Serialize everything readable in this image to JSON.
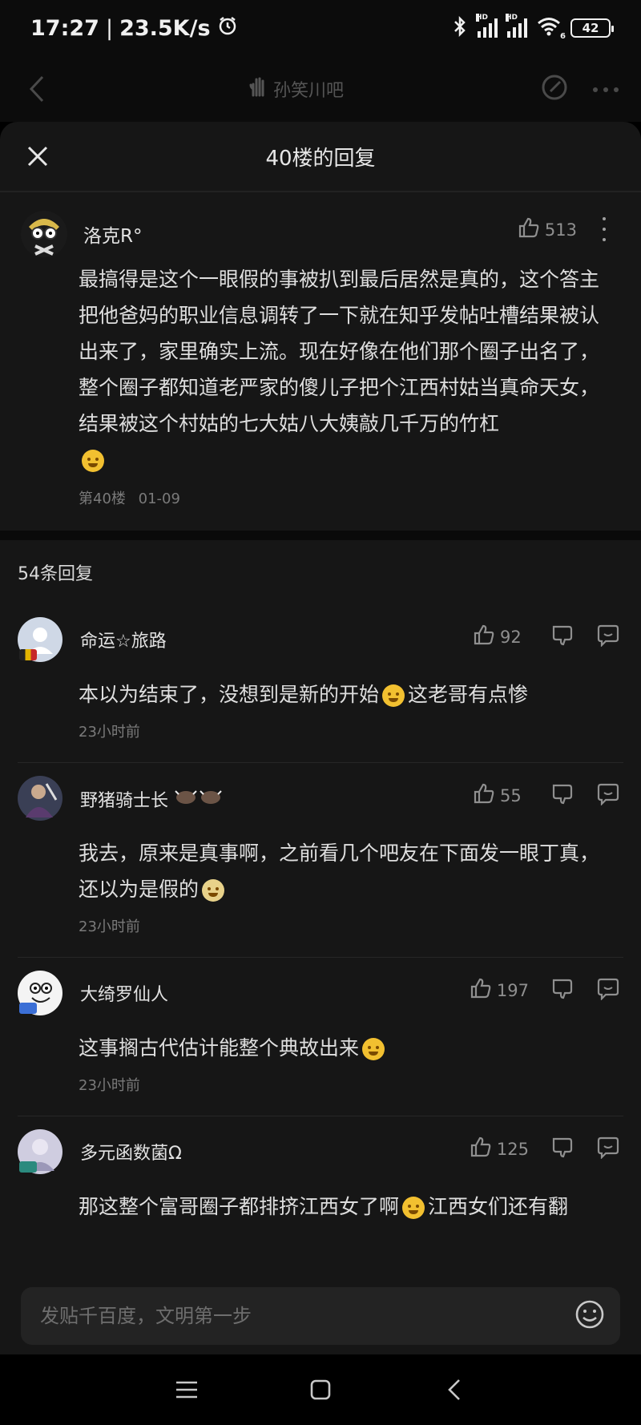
{
  "status_bar": {
    "time": "17:27",
    "net_speed": "23.5K/s",
    "hd1": "HD",
    "hd2": "HD",
    "wifi_sub": "6",
    "battery": "42"
  },
  "nav": {
    "forum_name": "孙笑川吧",
    "icons": [
      "back-chevron-icon",
      "forum-hand-icon",
      "edit-icon",
      "more-dots-icon"
    ]
  },
  "sheet": {
    "title": "40楼的回复"
  },
  "floor_post": {
    "username": "洛克R°",
    "likes": "513",
    "text": "最搞得是这个一眼假的事被扒到最后居然是真的，这个答主把他爸妈的职业信息调转了一下就在知乎发帖吐槽结果被认出来了，家里确实上流。现在好像在他们那个圈子出名了，整个圈子都知道老严家的傻儿子把个江西村姑当真命天女，结果被这个村姑的七大姑八大姨敲几千万的竹杠",
    "floor": "第40楼",
    "date": "01-09"
  },
  "reply_count": "54条回复",
  "replies": [
    {
      "username": "命运☆旅路",
      "likes": "92",
      "text_a": "本以为结束了，没想到是新的开始",
      "text_b": "这老哥有点惨",
      "time": "23小时前"
    },
    {
      "username": "野猪骑士长",
      "likes": "55",
      "text_a": "我去，原来是真事啊，之前看几个吧友在下面发一眼丁真，还以为是假的",
      "text_b": "",
      "time": "23小时前"
    },
    {
      "username": "大绮罗仙人",
      "likes": "197",
      "text_a": "这事搁古代估计能整个典故出来",
      "text_b": "",
      "time": "23小时前"
    },
    {
      "username": "多元函数菌Ω",
      "likes": "125",
      "text_a": "那这整个富哥圈子都排挤江西女了啊",
      "text_b": "江西女们还有翻",
      "time": ""
    }
  ],
  "input": {
    "placeholder": "发贴千百度，文明第一步"
  },
  "colors": {
    "background": "#161616",
    "text": "#dedede",
    "muted": "#7a7a7a",
    "emoji": "#f2c030"
  }
}
